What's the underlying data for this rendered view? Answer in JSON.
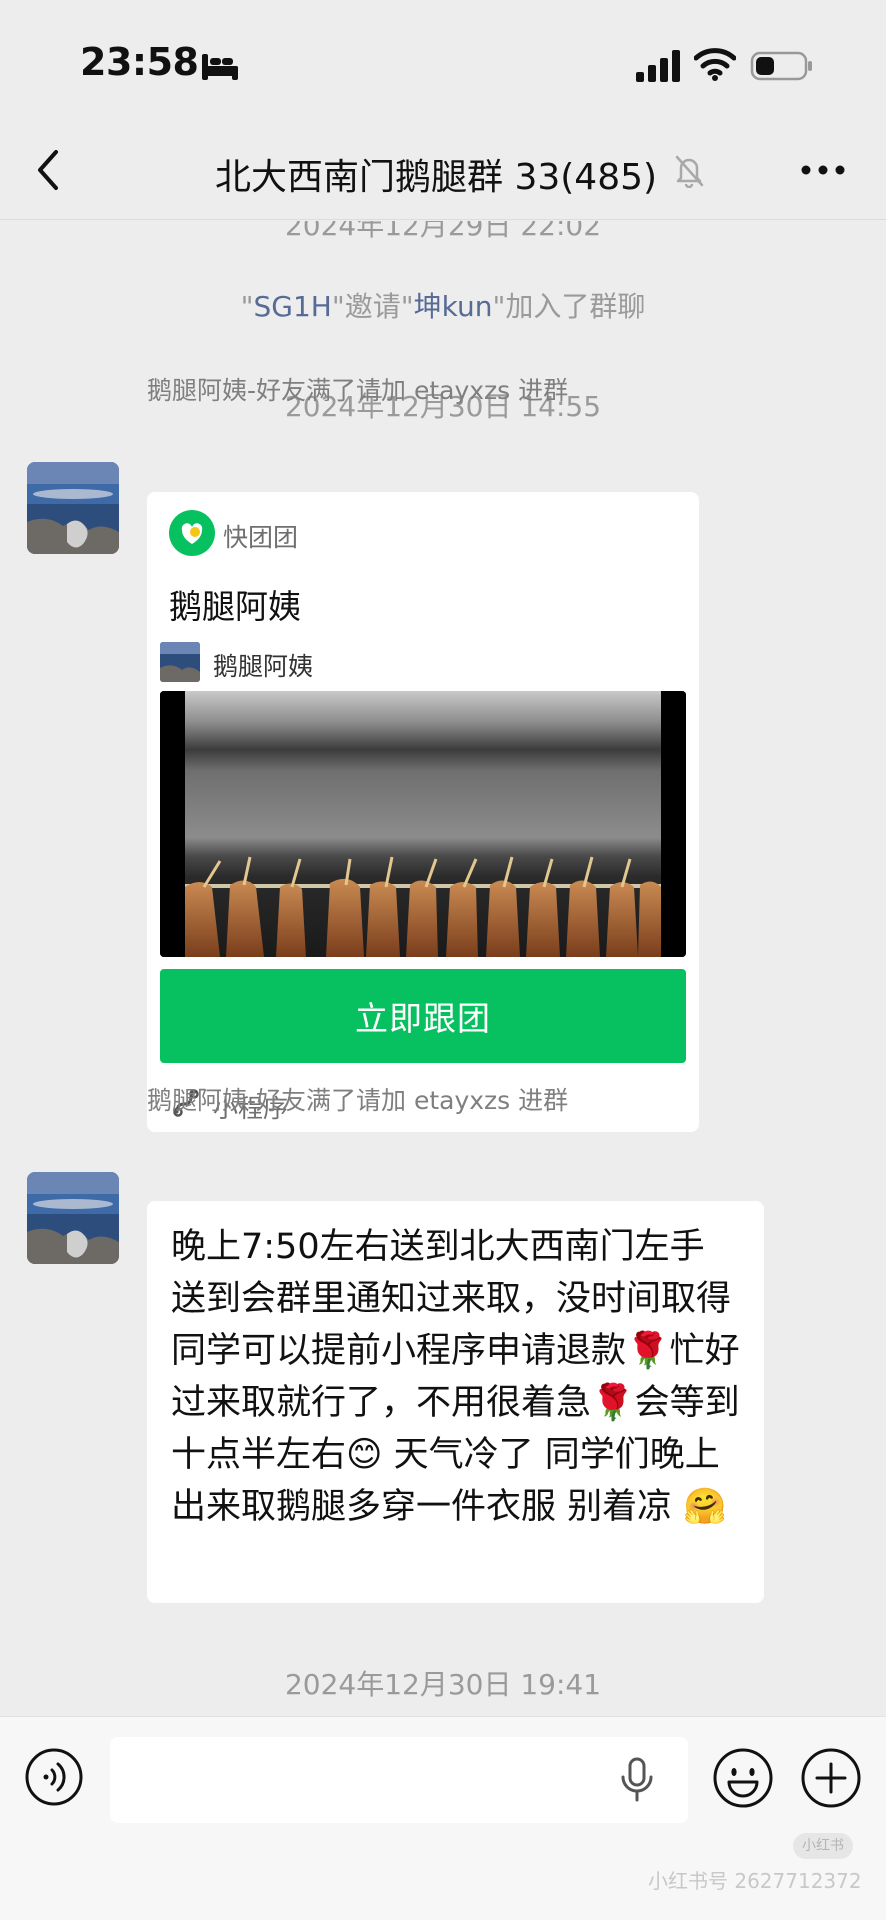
{
  "status_bar": {
    "time": "23:58"
  },
  "header": {
    "title": "北大西南门鹅腿群 33(485)"
  },
  "chat": {
    "partial_timestamp": "2024年12月29日 22:02",
    "system_message": {
      "q1": "\"",
      "inviter": "SG1H",
      "q2": "\"",
      "verb": "邀请",
      "q3": "\"",
      "invitee": "坤kun",
      "q4": "\"",
      "suffix": "加入了群聊"
    },
    "timestamp_1": "2024年12月30日 14:55",
    "message_1": {
      "sender": "鹅腿阿姨-好友满了请加 etayxzs 进群",
      "card": {
        "app_name": "快团团",
        "title": "鹅腿阿姨",
        "author": "鹅腿阿姨",
        "button_label": "立即跟团",
        "footer_label": "小程序"
      }
    },
    "message_2": {
      "sender": "鹅腿阿姨-好友满了请加 etayxzs 进群",
      "text": "晚上7:50左右送到北大西南门左手  送到会群里通知过来取，没时间取得同学可以提前小程序申请退款🌹忙好过来取就行了，不用很着急🌹会等到十点半左右😊 天气冷了 同学们晚上出来取鹅腿多穿一件衣服 别着凉 🤗"
    },
    "timestamp_2": "2024年12月30日 19:41"
  },
  "input_bar": {
    "watermark": "小红书号 2627712372",
    "logo_text": "小红书"
  },
  "colors": {
    "accent_green": "#07c160",
    "link_blue": "#576b95",
    "background": "#ededed"
  }
}
